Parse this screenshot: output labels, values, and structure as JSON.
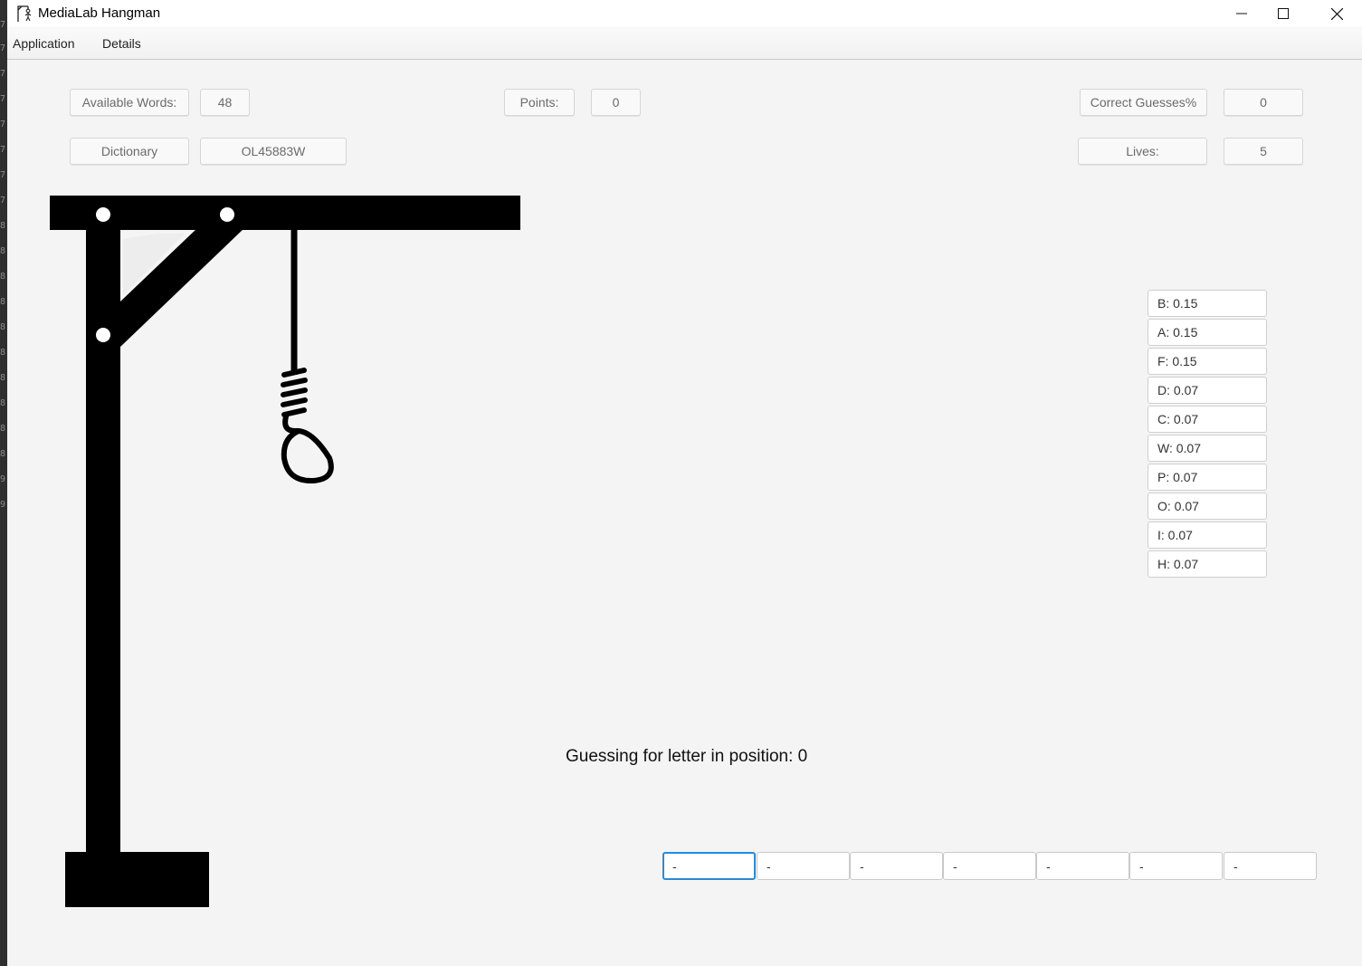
{
  "window": {
    "title": "MediaLab Hangman"
  },
  "menu": [
    "Application",
    "Details"
  ],
  "stats": {
    "available_words_label": "Available Words:",
    "available_words_value": "48",
    "points_label": "Points:",
    "points_value": "0",
    "correct_label": "Correct Guesses%",
    "correct_value": "0",
    "dictionary_label": "Dictionary",
    "dictionary_value": "OL45883W",
    "lives_label": "Lives:",
    "lives_value": "5"
  },
  "frequencies": [
    "B: 0.15",
    "A: 0.15",
    "F: 0.15",
    "D: 0.07",
    "C: 0.07",
    "W: 0.07",
    "P: 0.07",
    "O: 0.07",
    "I: 0.07",
    "H: 0.07"
  ],
  "guess_label": "Guessing for letter in position: 0",
  "word_slots": [
    "-",
    "-",
    "-",
    "-",
    "-",
    "-",
    "-"
  ],
  "active_slot": 0
}
